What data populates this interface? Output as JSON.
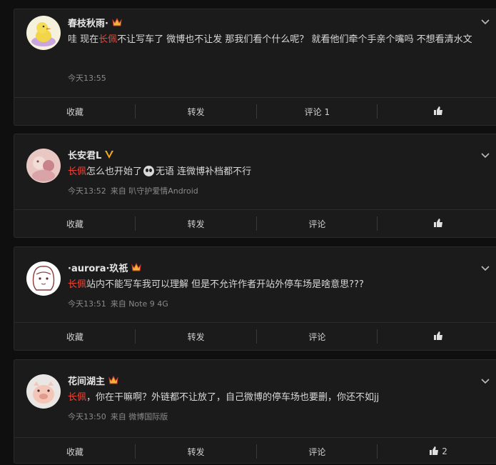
{
  "comments": [
    {
      "username": "春枝秋雨·",
      "badge": "crown",
      "mention": "长佩",
      "text_before": "哇 现在",
      "text_after": "不让写车了 微博也不让发 那我们看个什么呢？ 就看他们牵个手亲个嘴吗 不想看清水文",
      "time": "今天13:55",
      "source": "",
      "actions": {
        "collect": "收藏",
        "repost": "转发",
        "comment": "评论 1",
        "like": ""
      }
    },
    {
      "username": "长安君L",
      "badge": "verified-v",
      "mention": "长佩",
      "text_before": "",
      "text_mid": "怎么也开始了",
      "text_after": "无语 连微博补档都不行",
      "time": "今天13:52",
      "source": "来自 叭守护爱情Android",
      "actions": {
        "collect": "收藏",
        "repost": "转发",
        "comment": "评论",
        "like": ""
      }
    },
    {
      "username": "·aurora·玖祇",
      "badge": "crown",
      "mention": "长佩",
      "text_before": "",
      "text_after": "站内不能写车我可以理解 但是不允许作者开站外停车场是啥意思???",
      "time": "今天13:51",
      "source": "来自 Note 9 4G",
      "actions": {
        "collect": "收藏",
        "repost": "转发",
        "comment": "评论",
        "like": ""
      }
    },
    {
      "username": "花间湖主",
      "badge": "crown",
      "mention": "长佩",
      "text_before": "",
      "text_after": "，你在干嘛啊？外链都不让放了，自己微博的停车场也要删，你还不如jj",
      "time": "今天13:50",
      "source": "来自 微博国际版",
      "actions": {
        "collect": "收藏",
        "repost": "转发",
        "comment": "评论",
        "like": "2"
      }
    }
  ],
  "colors": {
    "mention": "#e8483b",
    "crown": "#f0b43a",
    "verified": "#f5a623"
  }
}
